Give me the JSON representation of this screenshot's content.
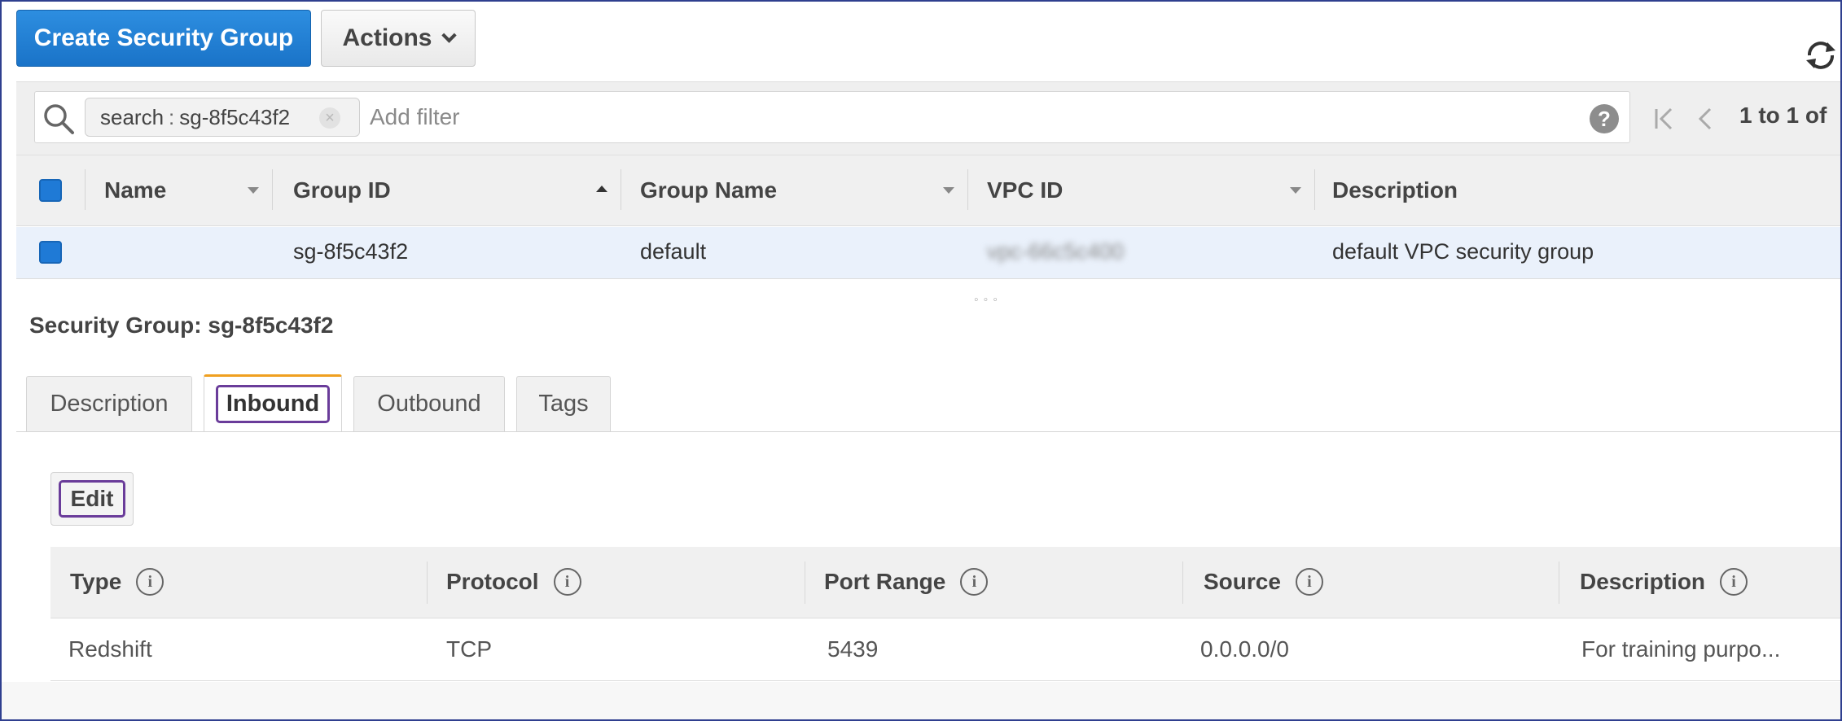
{
  "toolbar": {
    "create_label": "Create Security Group",
    "actions_label": "Actions"
  },
  "filter": {
    "token_key": "search",
    "token_sep": ":",
    "token_value": "sg-8f5c43f2",
    "placeholder": "Add filter",
    "help": "?",
    "pagination": "1 to 1 of"
  },
  "grid": {
    "columns": [
      "Name",
      "Group ID",
      "Group Name",
      "VPC ID",
      "Description"
    ],
    "rows": [
      {
        "name": "",
        "group_id": "sg-8f5c43f2",
        "group_name": "default",
        "vpc_id": "vpc-66c5c400",
        "description": "default VPC security group"
      }
    ]
  },
  "detail": {
    "title": "Security Group: sg-8f5c43f2",
    "tabs": [
      "Description",
      "Inbound",
      "Outbound",
      "Tags"
    ],
    "active_tab": "Inbound",
    "edit_label": "Edit",
    "rules": {
      "columns": [
        "Type",
        "Protocol",
        "Port Range",
        "Source",
        "Description"
      ],
      "rows": [
        {
          "type": "Redshift",
          "protocol": "TCP",
          "port_range": "5439",
          "source": "0.0.0.0/0",
          "description": "For training purpo..."
        }
      ]
    }
  },
  "icons": {
    "refresh": "refresh-icon",
    "search": "search-icon",
    "help": "help-icon",
    "first": "first-page-icon",
    "prev": "prev-page-icon",
    "info": "info-icon"
  },
  "colors": {
    "primary": "#1a73c8",
    "highlight": "#6a3c9a",
    "active_tab": "#f0a020",
    "selected_row": "#eaf1fb"
  }
}
